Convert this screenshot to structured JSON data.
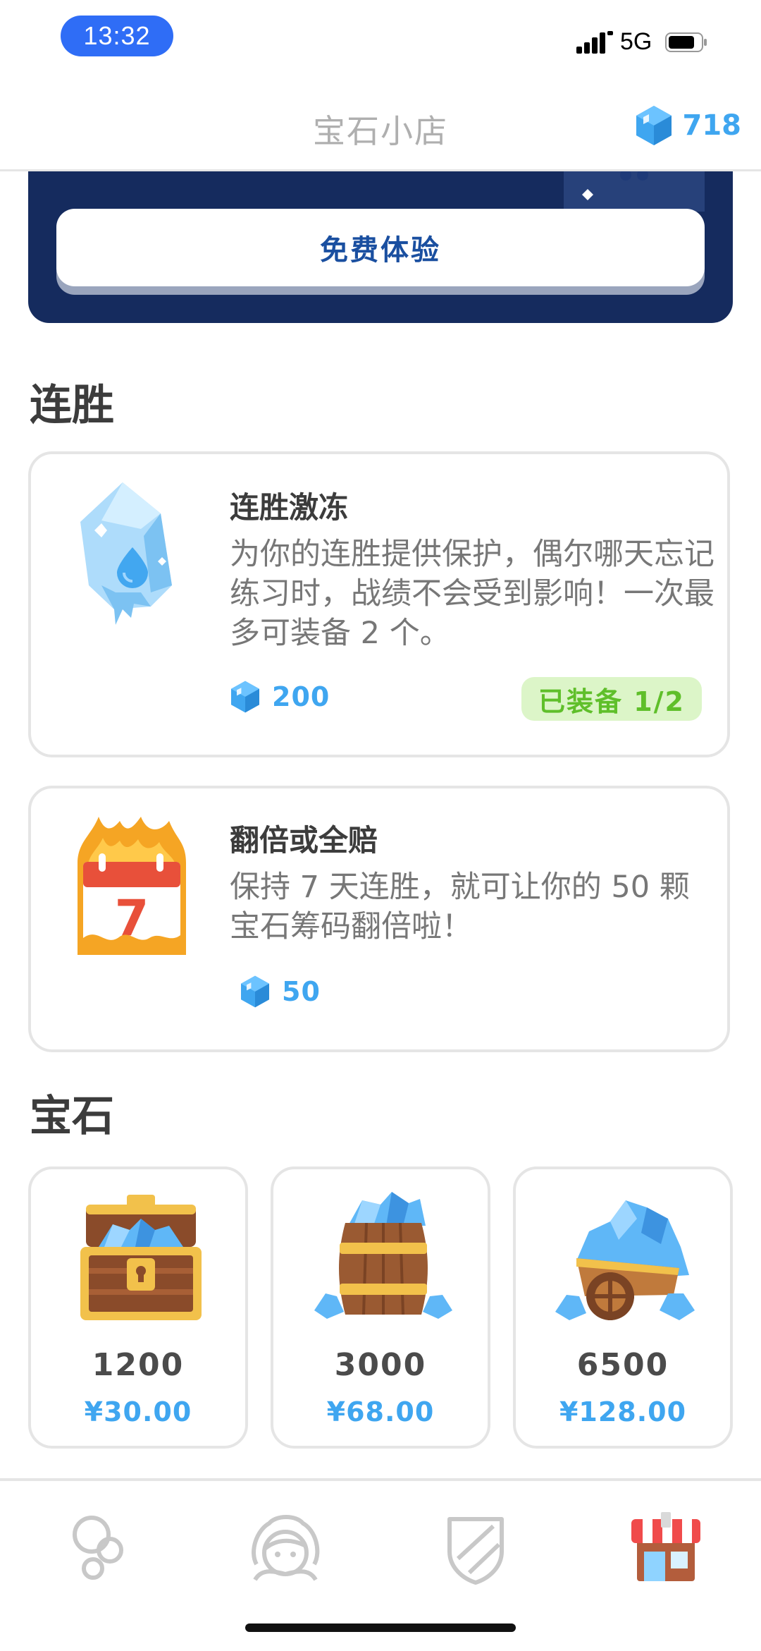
{
  "status_bar": {
    "time": "13:32",
    "network": "5G"
  },
  "header": {
    "title": "宝石小店",
    "gem_balance": "718"
  },
  "banner": {
    "free_trial_label": "免费体验"
  },
  "streak_section": {
    "title": "连胜",
    "items": [
      {
        "title": "连胜激冻",
        "description": "为你的连胜提供保护，偶尔哪天忘记练习时，战绩不会受到影响！一次最多可装备 2 个。",
        "price": "200",
        "status": "已装备 1/2"
      },
      {
        "title": "翻倍或全赔",
        "description": "保持 7 天连胜，就可让你的 50 颗宝石筹码翻倍啦！",
        "price": "50",
        "calendar_day": "7"
      }
    ]
  },
  "gems_section": {
    "title": "宝石",
    "packs": [
      {
        "amount": "1200",
        "price": "¥30.00"
      },
      {
        "amount": "3000",
        "price": "¥68.00"
      },
      {
        "amount": "6500",
        "price": "¥128.00"
      }
    ]
  },
  "bottom_nav": {
    "items": [
      "learn-tab",
      "profile-tab",
      "league-tab",
      "shop-tab"
    ],
    "active": "shop-tab"
  },
  "colors": {
    "gem_blue": "#3fa6f0",
    "equipped_green": "#5fbf2a",
    "banner_navy": "#152b5e"
  }
}
